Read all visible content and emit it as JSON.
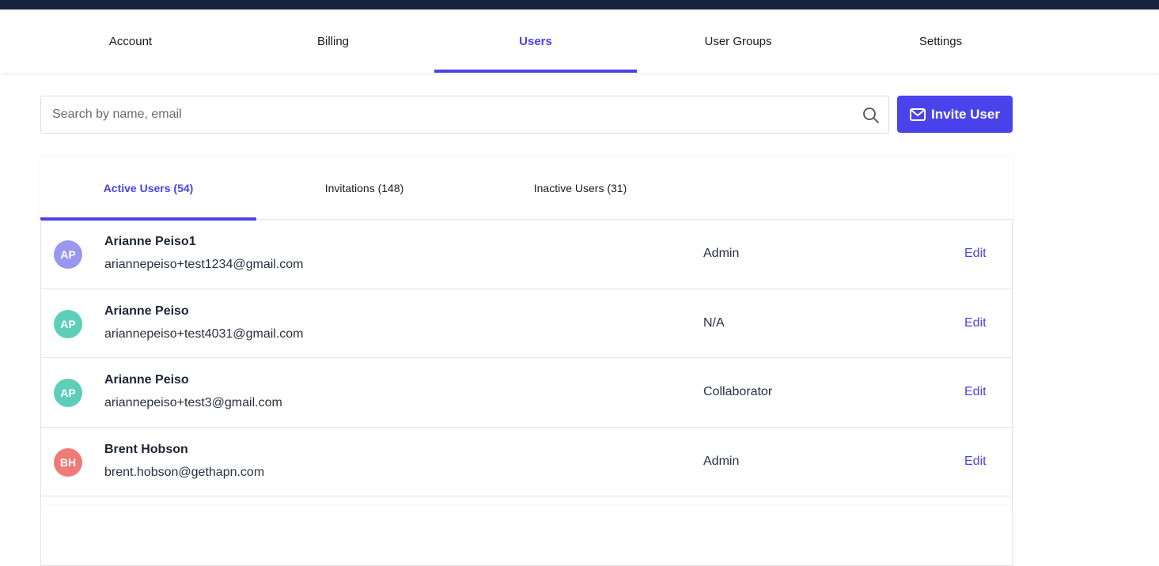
{
  "nav": {
    "tabs": [
      {
        "label": "Account"
      },
      {
        "label": "Billing"
      },
      {
        "label": "Users"
      },
      {
        "label": "User Groups"
      },
      {
        "label": "Settings"
      }
    ],
    "active_tab": "Users"
  },
  "search": {
    "placeholder": "Search by name, email",
    "value": ""
  },
  "invite_button": {
    "label": "Invite User",
    "icon": "envelope-icon"
  },
  "user_tabs": {
    "tabs": [
      {
        "label": "Active Users (54)"
      },
      {
        "label": "Invitations (148)"
      },
      {
        "label": "Inactive Users (31)"
      }
    ],
    "active_tab": "Active Users (54)"
  },
  "users": [
    {
      "initials": "AP",
      "name": "Arianne Peiso1",
      "email": "ariannepeiso+test1234@gmail.com",
      "role": "Admin",
      "action": "Edit",
      "avatar_color": "#9a97ee"
    },
    {
      "initials": "AP",
      "name": "Arianne Peiso",
      "email": "ariannepeiso+test4031@gmail.com",
      "role": "N/A",
      "action": "Edit",
      "avatar_color": "#5dcfb9"
    },
    {
      "initials": "AP",
      "name": "Arianne Peiso",
      "email": "ariannepeiso+test3@gmail.com",
      "role": "Collaborator",
      "action": "Edit",
      "avatar_color": "#5dcfb9"
    },
    {
      "initials": "BH",
      "name": "Brent Hobson",
      "email": "brent.hobson@gethapn.com",
      "role": "Admin",
      "action": "Edit",
      "avatar_color": "#f07a78"
    }
  ],
  "colors": {
    "accent": "#4a43e6",
    "topbar": "#15233f"
  }
}
